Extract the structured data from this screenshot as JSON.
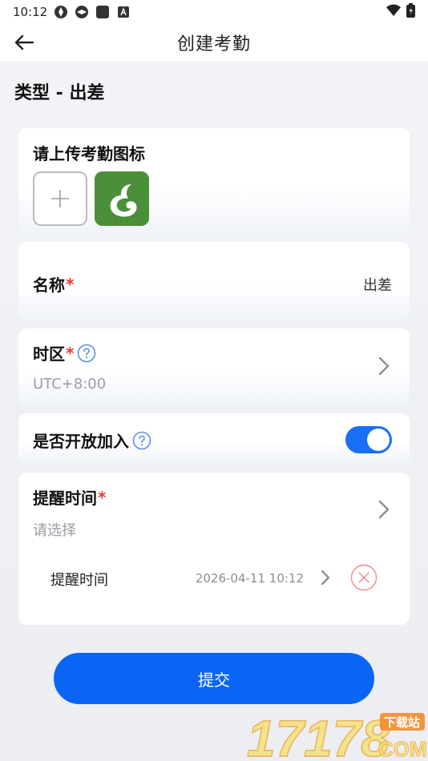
{
  "status_bar": {
    "time": "10:12",
    "notification_icons": [
      "aperture-icon",
      "aperture-icon",
      "square-icon",
      "a-badge-icon"
    ],
    "right_icons": [
      "wifi-icon",
      "battery-icon"
    ]
  },
  "header": {
    "title": "创建考勤",
    "back_icon": "arrow-left-icon"
  },
  "type_title": "类型 - 出差",
  "icon_card": {
    "label": "请上传考勤图标",
    "upload_icon": "plus-icon"
  },
  "name_card": {
    "label": "名称",
    "required_mark": "*",
    "value": "出差"
  },
  "timezone_card": {
    "label": "时区",
    "required_mark": "*",
    "value": "UTC+8:00"
  },
  "open_card": {
    "label": "是否开放加入",
    "enabled": true
  },
  "remind_card": {
    "label": "提醒时间",
    "required_mark": "*",
    "placeholder": "请选择",
    "entries": [
      {
        "label": "提醒时间",
        "time": "2026-04-11 10:12"
      }
    ]
  },
  "submit_label": "提交",
  "watermark": {
    "number": "17178",
    "tag": "下载站",
    "suffix": "COM"
  },
  "colors": {
    "primary": "#0a65f5",
    "toggle_on": "#1a6ff5",
    "required": "#e53935",
    "delete": "#f08a8a",
    "app_icon_bg": "#4b8f3a"
  }
}
